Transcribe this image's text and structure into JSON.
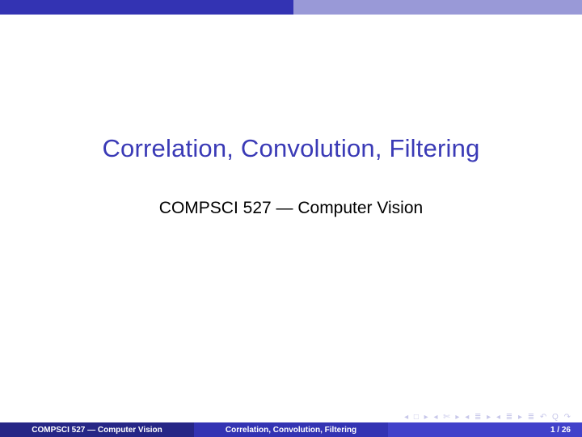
{
  "title": "Correlation, Convolution, Filtering",
  "subtitle": "COMPSCI 527 — Computer Vision",
  "footer": {
    "left": "COMPSCI 527 — Computer Vision",
    "center": "Correlation, Convolution, Filtering",
    "right": "1 / 26"
  },
  "nav_symbols": "◂ □ ▸  ◂ ✄ ▸  ◂ ≣ ▸  ◂ ≣ ▸   ≣   ↶ Q ↷"
}
